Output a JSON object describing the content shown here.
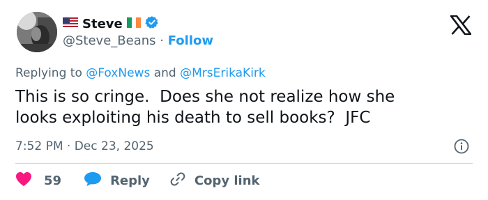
{
  "author": {
    "display_name": "Steve",
    "handle": "@Steve_Beans",
    "separator": "·",
    "follow_label": "Follow",
    "badges": [
      "us-flag-icon",
      "ireland-flag-icon",
      "verified-badge-icon"
    ]
  },
  "platform": {
    "logo": "x-logo-icon"
  },
  "tweet": {
    "replying_prefix": "Replying to",
    "reply_to": [
      "@FoxNews",
      "@MrsErikaKirk"
    ],
    "replying_joiner": "and",
    "text_lines": [
      "This is so cringe.  Does she not realize how she",
      "looks exploiting his death to sell books?  JFC"
    ],
    "time": "7:52 PM",
    "meta_separator": "·",
    "date": "Dec 23, 2025"
  },
  "actions": {
    "like_count": "59",
    "reply_label": "Reply",
    "copy_link_label": "Copy link"
  },
  "colors": {
    "accent": "#1d9bf0",
    "like": "#f91880",
    "text": "#0f1419",
    "secondary": "#536471",
    "divider": "#cfd9de"
  }
}
